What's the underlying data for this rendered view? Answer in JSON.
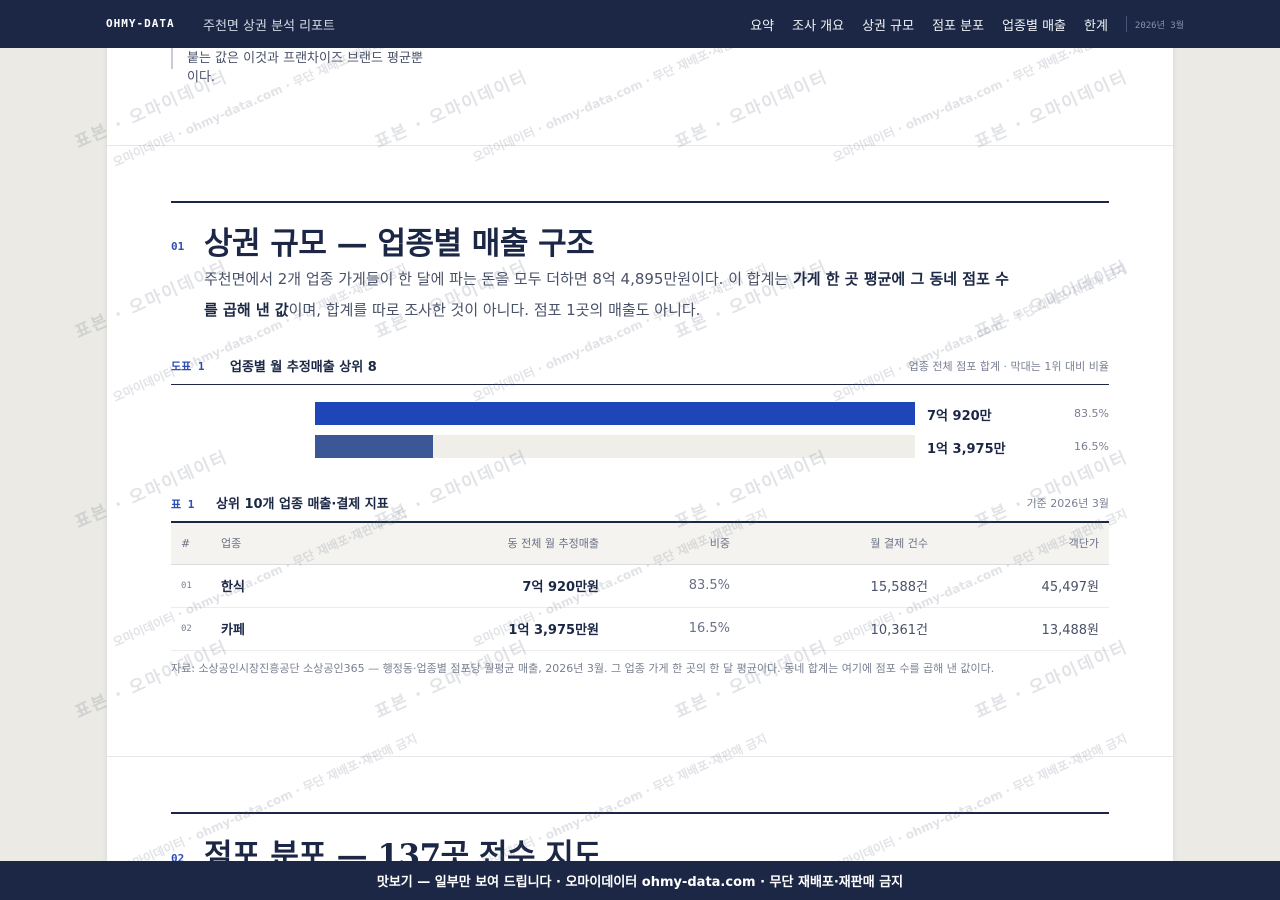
{
  "header": {
    "brand": "OHMY-DATA",
    "report_title": "주천면 상권 분석 리포트",
    "nav": [
      "요약",
      "조사 개요",
      "상권 규모",
      "점포 분포",
      "업종별 매출",
      "한계"
    ],
    "date": "2026년 3월"
  },
  "intro_quote": {
    "line1": "붙는 값은 이것과 프랜차이즈 브랜드 평균뿐",
    "line2": "이다."
  },
  "section1": {
    "num": "01",
    "title": "상권 규모 — 업종별 매출 구조",
    "lead_a": "주천면에서 2개 업종 가게들이 한 달에 파는 돈을 모두 더하면 8억 4,895만원이다. 이 합계는 ",
    "lead_b": "가게 한 곳 평균에 그 동네 점포 수를 곱해 낸 값",
    "lead_c": "이며, 합계를 따로 조사한 것이 아니다. 점포 1곳의 매출도 아니다."
  },
  "figure1": {
    "label": "도표 1",
    "title": "업종별 월 추정매출 상위 8",
    "note": "업종 전체 점포 합계 · 막대는 1위 대비 비율",
    "bars": [
      {
        "name": "한식",
        "value_label": "7억 920만",
        "pct": "83.5%",
        "ratio": 1.0,
        "color": "#1e46b8"
      },
      {
        "name": "카페",
        "value_label": "1억 3,975만",
        "pct": "16.5%",
        "ratio": 0.197,
        "color": "#3b5795"
      }
    ]
  },
  "table1": {
    "label": "표 1",
    "title": "상위 10개 업종 매출·결제 지표",
    "note": "기준 2026년 3월",
    "columns": [
      "#",
      "업종",
      "동 전체 월 추정매출",
      "비중",
      "월 결제 건수",
      "객단가"
    ],
    "rows": [
      {
        "idx": "01",
        "name": "한식",
        "sales": "7억 920만원",
        "share": "83.5%",
        "count": "15,588건",
        "avg": "45,497원"
      },
      {
        "idx": "02",
        "name": "카페",
        "sales": "1억 3,975만원",
        "share": "16.5%",
        "count": "10,361건",
        "avg": "13,488원"
      }
    ],
    "source": "자료: 소상공인시장진흥공단 소상공인365 — 행정동·업종별 점포당 월평균 매출, 2026년 3월. 그 업종 가게 한 곳의 한 달 평균이다. 동네 합계는 여기에 점포 수를 곱해 낸 값이다."
  },
  "section2": {
    "num": "02",
    "title": "점포 분포 — 137곳 전수 지도"
  },
  "watermark": {
    "big": "표본 · 오마이데이터",
    "small": "오마이데이터 · ohmy-data.com · 무단 재배포·재판매 금지"
  },
  "footer": {
    "text": "맛보기 — 일부만 보여 드립니다 · 오마이데이터 ohmy-data.com · 무단 재배포·재판매 금지"
  }
}
